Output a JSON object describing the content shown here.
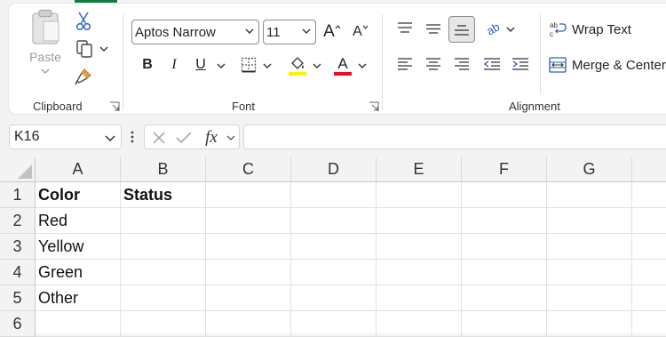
{
  "clipboard": {
    "paste_label": "Paste",
    "group_label": "Clipboard"
  },
  "font": {
    "font_name": "Aptos Narrow",
    "font_size": "11",
    "group_label": "Font",
    "bold": "B",
    "italic": "I",
    "underline": "U",
    "font_color_letter": "A",
    "grow_letter": "A",
    "shrink_letter": "A",
    "highlight_color": "#ffef00",
    "font_color": "#e81123"
  },
  "alignment": {
    "wrap_text_label": "Wrap Text",
    "merge_label": "Merge & Center",
    "group_label": "Alignment",
    "orientation_letters": "ab"
  },
  "formula_bar": {
    "name_box": "K16",
    "fx_label": "fx",
    "formula": ""
  },
  "sheet": {
    "columns": [
      "A",
      "B",
      "C",
      "D",
      "E",
      "F",
      "G"
    ],
    "rows": [
      "1",
      "2",
      "3",
      "4",
      "5",
      "6"
    ],
    "cells": {
      "A1": "Color",
      "B1": "Status",
      "A2": "Red",
      "A3": "Yellow",
      "A4": "Green",
      "A5": "Other"
    }
  },
  "colors": {
    "accent_green": "#107c41"
  }
}
